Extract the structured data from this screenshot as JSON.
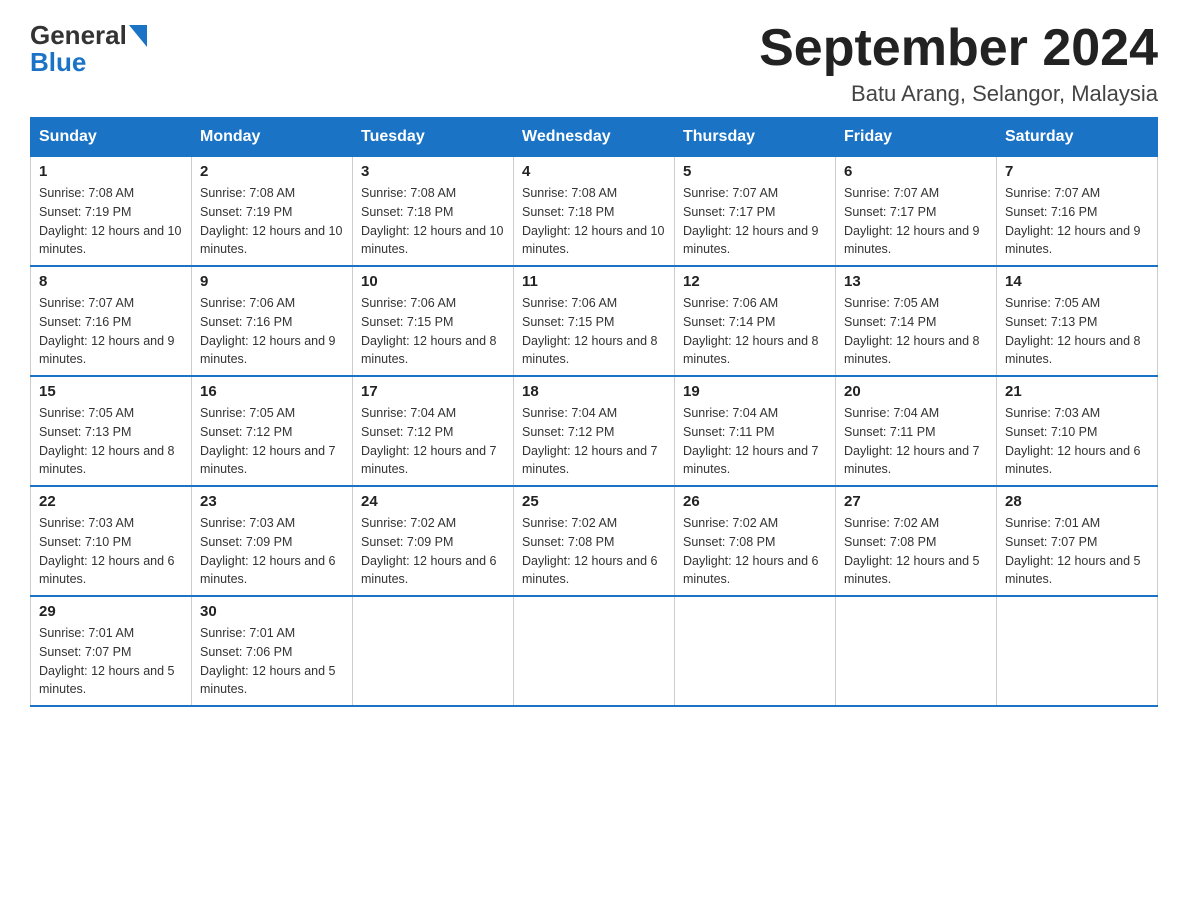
{
  "header": {
    "logo_general": "General",
    "logo_blue": "Blue",
    "title": "September 2024",
    "subtitle": "Batu Arang, Selangor, Malaysia"
  },
  "columns": [
    "Sunday",
    "Monday",
    "Tuesday",
    "Wednesday",
    "Thursday",
    "Friday",
    "Saturday"
  ],
  "weeks": [
    [
      {
        "day": "1",
        "sunrise": "7:08 AM",
        "sunset": "7:19 PM",
        "daylight": "12 hours and 10 minutes."
      },
      {
        "day": "2",
        "sunrise": "7:08 AM",
        "sunset": "7:19 PM",
        "daylight": "12 hours and 10 minutes."
      },
      {
        "day": "3",
        "sunrise": "7:08 AM",
        "sunset": "7:18 PM",
        "daylight": "12 hours and 10 minutes."
      },
      {
        "day": "4",
        "sunrise": "7:08 AM",
        "sunset": "7:18 PM",
        "daylight": "12 hours and 10 minutes."
      },
      {
        "day": "5",
        "sunrise": "7:07 AM",
        "sunset": "7:17 PM",
        "daylight": "12 hours and 9 minutes."
      },
      {
        "day": "6",
        "sunrise": "7:07 AM",
        "sunset": "7:17 PM",
        "daylight": "12 hours and 9 minutes."
      },
      {
        "day": "7",
        "sunrise": "7:07 AM",
        "sunset": "7:16 PM",
        "daylight": "12 hours and 9 minutes."
      }
    ],
    [
      {
        "day": "8",
        "sunrise": "7:07 AM",
        "sunset": "7:16 PM",
        "daylight": "12 hours and 9 minutes."
      },
      {
        "day": "9",
        "sunrise": "7:06 AM",
        "sunset": "7:16 PM",
        "daylight": "12 hours and 9 minutes."
      },
      {
        "day": "10",
        "sunrise": "7:06 AM",
        "sunset": "7:15 PM",
        "daylight": "12 hours and 8 minutes."
      },
      {
        "day": "11",
        "sunrise": "7:06 AM",
        "sunset": "7:15 PM",
        "daylight": "12 hours and 8 minutes."
      },
      {
        "day": "12",
        "sunrise": "7:06 AM",
        "sunset": "7:14 PM",
        "daylight": "12 hours and 8 minutes."
      },
      {
        "day": "13",
        "sunrise": "7:05 AM",
        "sunset": "7:14 PM",
        "daylight": "12 hours and 8 minutes."
      },
      {
        "day": "14",
        "sunrise": "7:05 AM",
        "sunset": "7:13 PM",
        "daylight": "12 hours and 8 minutes."
      }
    ],
    [
      {
        "day": "15",
        "sunrise": "7:05 AM",
        "sunset": "7:13 PM",
        "daylight": "12 hours and 8 minutes."
      },
      {
        "day": "16",
        "sunrise": "7:05 AM",
        "sunset": "7:12 PM",
        "daylight": "12 hours and 7 minutes."
      },
      {
        "day": "17",
        "sunrise": "7:04 AM",
        "sunset": "7:12 PM",
        "daylight": "12 hours and 7 minutes."
      },
      {
        "day": "18",
        "sunrise": "7:04 AM",
        "sunset": "7:12 PM",
        "daylight": "12 hours and 7 minutes."
      },
      {
        "day": "19",
        "sunrise": "7:04 AM",
        "sunset": "7:11 PM",
        "daylight": "12 hours and 7 minutes."
      },
      {
        "day": "20",
        "sunrise": "7:04 AM",
        "sunset": "7:11 PM",
        "daylight": "12 hours and 7 minutes."
      },
      {
        "day": "21",
        "sunrise": "7:03 AM",
        "sunset": "7:10 PM",
        "daylight": "12 hours and 6 minutes."
      }
    ],
    [
      {
        "day": "22",
        "sunrise": "7:03 AM",
        "sunset": "7:10 PM",
        "daylight": "12 hours and 6 minutes."
      },
      {
        "day": "23",
        "sunrise": "7:03 AM",
        "sunset": "7:09 PM",
        "daylight": "12 hours and 6 minutes."
      },
      {
        "day": "24",
        "sunrise": "7:02 AM",
        "sunset": "7:09 PM",
        "daylight": "12 hours and 6 minutes."
      },
      {
        "day": "25",
        "sunrise": "7:02 AM",
        "sunset": "7:08 PM",
        "daylight": "12 hours and 6 minutes."
      },
      {
        "day": "26",
        "sunrise": "7:02 AM",
        "sunset": "7:08 PM",
        "daylight": "12 hours and 6 minutes."
      },
      {
        "day": "27",
        "sunrise": "7:02 AM",
        "sunset": "7:08 PM",
        "daylight": "12 hours and 5 minutes."
      },
      {
        "day": "28",
        "sunrise": "7:01 AM",
        "sunset": "7:07 PM",
        "daylight": "12 hours and 5 minutes."
      }
    ],
    [
      {
        "day": "29",
        "sunrise": "7:01 AM",
        "sunset": "7:07 PM",
        "daylight": "12 hours and 5 minutes."
      },
      {
        "day": "30",
        "sunrise": "7:01 AM",
        "sunset": "7:06 PM",
        "daylight": "12 hours and 5 minutes."
      },
      null,
      null,
      null,
      null,
      null
    ]
  ]
}
